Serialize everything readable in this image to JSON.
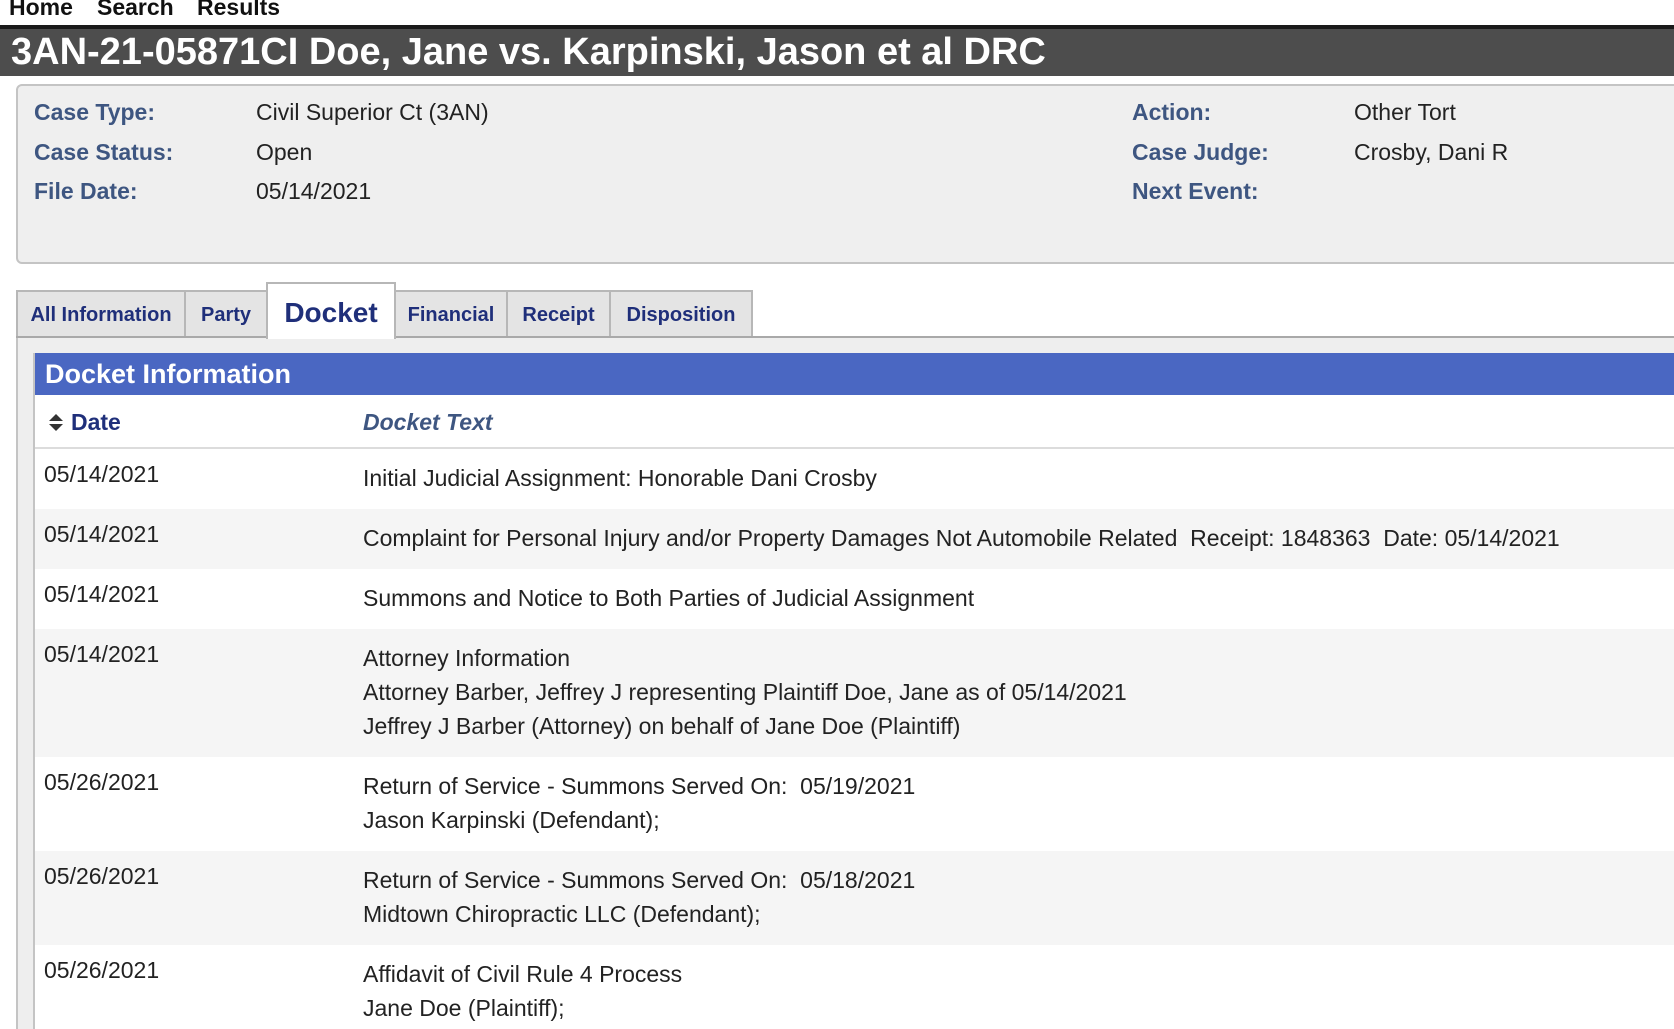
{
  "nav": {
    "home": "Home",
    "search": "Search",
    "results": "Results"
  },
  "title": "3AN-21-05871CI Doe, Jane vs. Karpinski, Jason et al DRC",
  "summary": {
    "case_type_label": "Case Type:",
    "case_type_value": "Civil Superior Ct (3AN)",
    "case_status_label": "Case Status:",
    "case_status_value": "Open",
    "file_date_label": "File Date:",
    "file_date_value": "05/14/2021",
    "action_label": "Action:",
    "action_value": "Other Tort",
    "case_judge_label": "Case Judge:",
    "case_judge_value": "Crosby, Dani R",
    "next_event_label": "Next Event:",
    "next_event_value": ""
  },
  "tabs": [
    {
      "label": "All Information"
    },
    {
      "label": "Party"
    },
    {
      "label": "Docket"
    },
    {
      "label": "Financial"
    },
    {
      "label": "Receipt"
    },
    {
      "label": "Disposition"
    }
  ],
  "active_tab": "Docket",
  "docket": {
    "header": "Docket Information",
    "col_date": "Date",
    "col_text": "Docket Text",
    "sort_icon": "sort-up-down-icon",
    "rows": [
      {
        "date": "05/14/2021",
        "lines": [
          "Initial Judicial Assignment: Honorable Dani Crosby"
        ]
      },
      {
        "date": "05/14/2021",
        "lines": [
          "Complaint for Personal Injury and/or Property Damages Not Automobile Related  Receipt: 1848363  Date: 05/14/2021"
        ]
      },
      {
        "date": "05/14/2021",
        "lines": [
          "Summons and Notice to Both Parties of Judicial Assignment"
        ]
      },
      {
        "date": "05/14/2021",
        "lines": [
          "Attorney Information",
          "Attorney Barber, Jeffrey J representing Plaintiff Doe, Jane as of 05/14/2021",
          "Jeffrey J Barber (Attorney) on behalf of Jane Doe (Plaintiff)"
        ]
      },
      {
        "date": "05/26/2021",
        "lines": [
          "Return of Service - Summons Served On:  05/19/2021",
          "Jason Karpinski (Defendant);"
        ]
      },
      {
        "date": "05/26/2021",
        "lines": [
          "Return of Service - Summons Served On:  05/18/2021",
          "Midtown Chiropractic LLC (Defendant);"
        ]
      },
      {
        "date": "05/26/2021",
        "lines": [
          "Affidavit of Civil Rule 4 Process",
          "Jane Doe (Plaintiff);"
        ]
      }
    ]
  },
  "colors": {
    "title_bar": "#4d4d4d",
    "docket_header": "#4a67c2",
    "label": "#3e5681",
    "tab_text": "#1f2f7a"
  }
}
